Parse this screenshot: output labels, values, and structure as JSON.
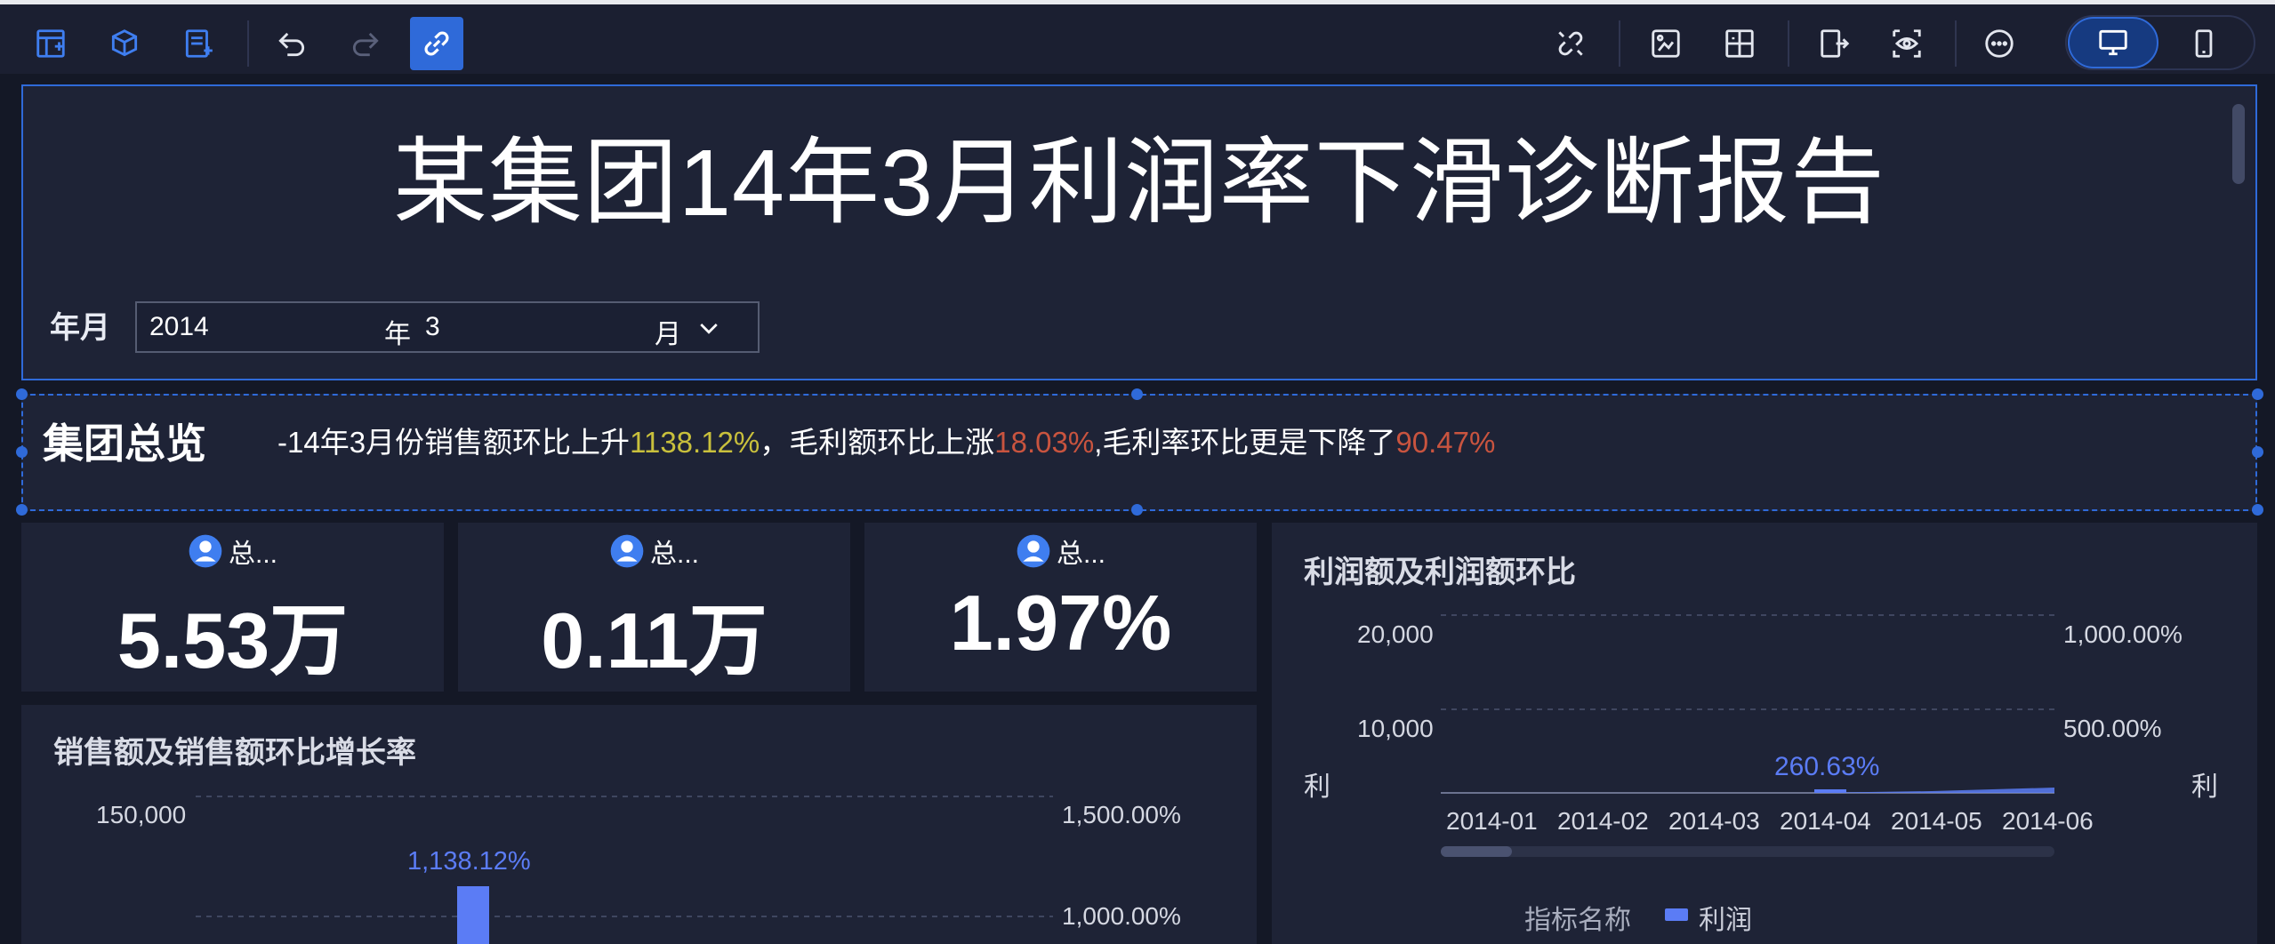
{
  "toolbar": {
    "left_icons": [
      "add-component-icon",
      "add-cube-icon",
      "add-report-icon",
      "undo-icon",
      "redo-icon",
      "link-icon"
    ],
    "right_icons": [
      "unlink-icon",
      "image-edit-icon",
      "grid-icon",
      "export-icon",
      "preview-icon",
      "more-icon",
      "desktop-icon",
      "mobile-icon"
    ]
  },
  "header": {
    "title": "某集团14年3月利润率下滑诊断报告",
    "filter_label": "年月",
    "year_value": "2014",
    "year_unit": "年",
    "month_value": "3",
    "month_unit": "月"
  },
  "overview": {
    "title": "集团总览",
    "text_1": "-14年3月份销售额环比上升",
    "value_1": "1138.12%",
    "text_2": "，毛利额环比上涨",
    "value_2": "18.03%",
    "text_3": ",毛利率环比更是下降了",
    "value_3": "90.47%"
  },
  "kpis": [
    {
      "label": "总...",
      "value": "5.53万"
    },
    {
      "label": "总...",
      "value": "0.11万"
    },
    {
      "label": "总...",
      "value": "1.97%"
    }
  ],
  "colors": {
    "accent": "#2f6ad9",
    "series": "#5b7cf5",
    "highlight_up": "#c9c03c",
    "highlight_down": "#c9543f",
    "panel_bg": "#1e2336"
  },
  "sales_panel": {
    "title": "销售额及销售额环比增长率",
    "left_ticks": [
      "150,000"
    ],
    "right_ticks": [
      "1,500.00%",
      "1,000.00%"
    ],
    "bar_label": "1,138.12%"
  },
  "profit_panel": {
    "title": "利润额及利润额环比",
    "left_ticks": [
      "20,000",
      "10,000"
    ],
    "right_ticks": [
      "1,000.00%",
      "500.00%"
    ],
    "left_axis_label": "利",
    "right_axis_label": "利",
    "x_labels": [
      "2014-01",
      "2014-02",
      "2014-03",
      "2014-04",
      "2014-05",
      "2014-06"
    ],
    "point_label": "260.63%",
    "legend_title": "指标名称",
    "legend_series": "利润"
  },
  "chart_data": [
    {
      "type": "bar",
      "title": "销售额及销售额环比增长率",
      "y_right_ticks": [
        "1,500.00%",
        "1,000.00%"
      ],
      "y_left_ticks": [
        "150,000"
      ],
      "series": [
        {
          "values": [
            1138.12
          ]
        }
      ]
    },
    {
      "type": "area",
      "title": "利润额及利润额环比",
      "categories": [
        "2014-01",
        "2014-02",
        "2014-03",
        "2014-04",
        "2014-05",
        "2014-06"
      ],
      "ylim_left": [
        0,
        20000
      ],
      "ylim_right": [
        0,
        1000
      ],
      "series": [
        {
          "name": "利润",
          "values": [
            0,
            0,
            0,
            0,
            200,
            600
          ]
        }
      ],
      "annotations": [
        "260.63%"
      ],
      "legend": "bottom"
    }
  ]
}
